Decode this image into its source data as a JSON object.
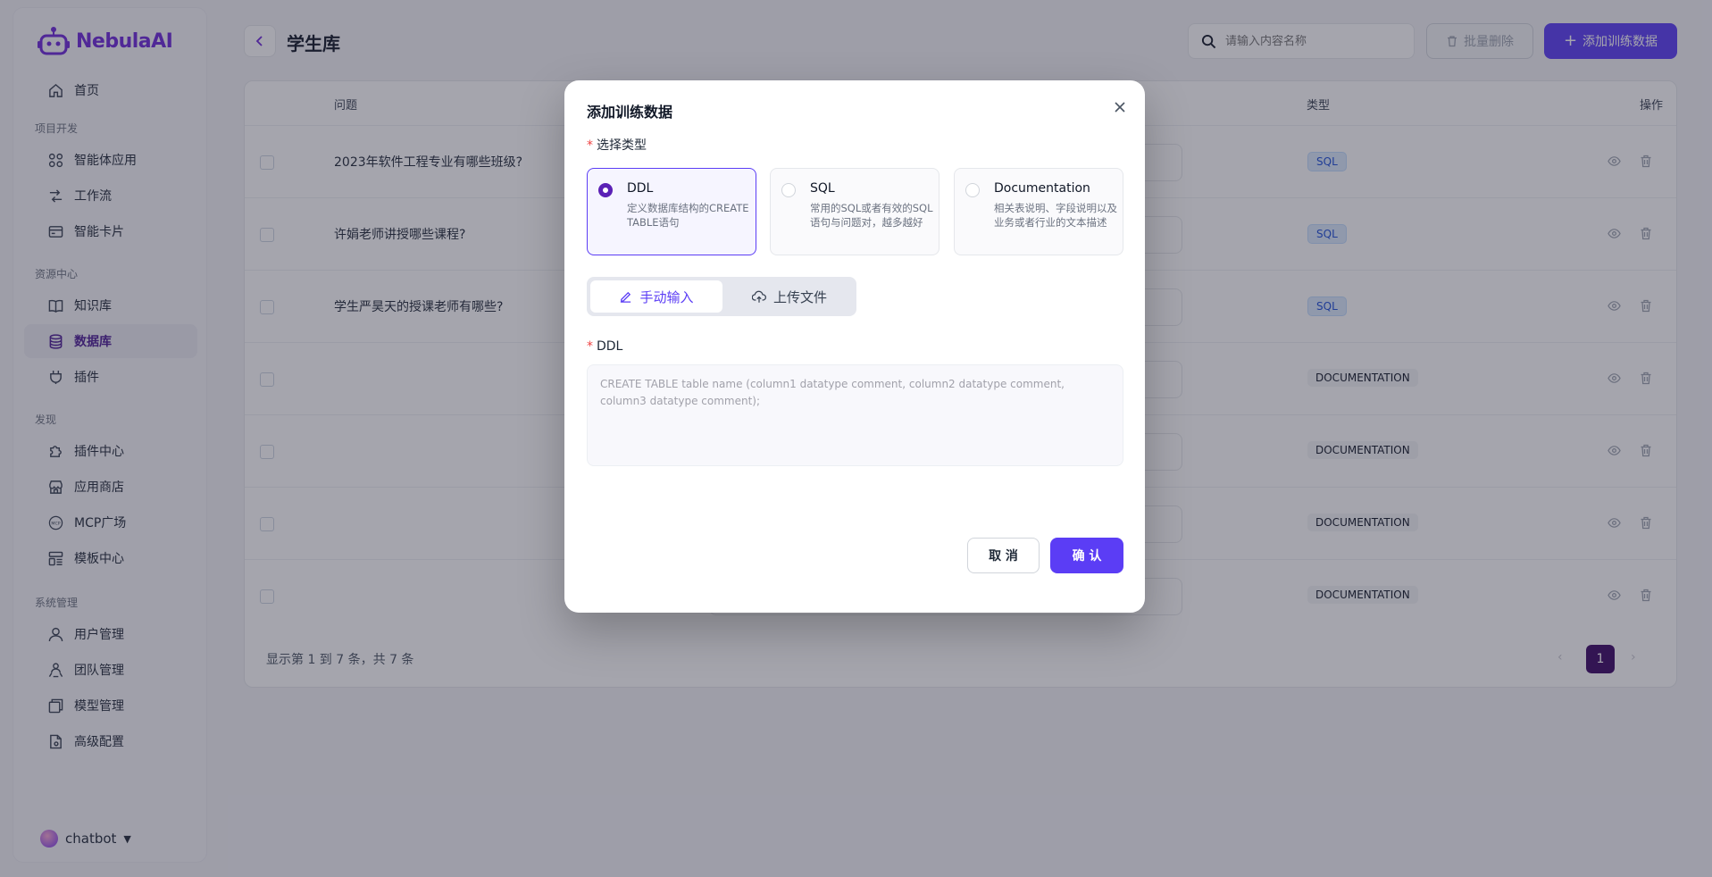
{
  "brand": {
    "name": "NebulaAI",
    "accent": "#6d28d9",
    "primary": "#5b3df5"
  },
  "sidebar": {
    "home": "首页",
    "sections": {
      "project": "项目开发",
      "resource": "资源中心",
      "discover": "发现",
      "system": "系统管理"
    },
    "items": {
      "agent_app": "智能体应用",
      "workflow": "工作流",
      "smart_card": "智能卡片",
      "knowledge": "知识库",
      "database": "数据库",
      "plugin": "插件",
      "plugin_center": "插件中心",
      "app_store": "应用商店",
      "mcp": "MCP广场",
      "template": "模板中心",
      "user_mgmt": "用户管理",
      "team_mgmt": "团队管理",
      "model_mgmt": "模型管理",
      "advanced": "高级配置"
    },
    "user": "chatbot"
  },
  "header": {
    "title": "学生库",
    "search_placeholder": "请输入内容名称",
    "batch_delete": "批量删除",
    "add_training": "添加训练数据"
  },
  "table": {
    "columns": {
      "question": "问题",
      "type": "类型",
      "action": "操作"
    },
    "rows": [
      {
        "question": "2023年软件工程专业有哪些班级?",
        "type": "SQL"
      },
      {
        "question": "许娟老师讲授哪些课程?",
        "type": "SQL"
      },
      {
        "question": "学生严昊天的授课老师有哪些?",
        "type": "SQL"
      },
      {
        "question": "",
        "type": "DOCUMENTATION"
      },
      {
        "question": "",
        "type": "DOCUMENTATION"
      },
      {
        "question": "",
        "type": "DOCUMENTATION"
      },
      {
        "question": "",
        "type": "DOCUMENTATION"
      }
    ],
    "footer": "显示第 1 到 7 条，共 7 条",
    "current_page": "1"
  },
  "modal": {
    "title": "添加训练数据",
    "select_type_label": "选择类型",
    "types": [
      {
        "title": "DDL",
        "desc": "定义数据库结构的CREATE TABLE语句",
        "selected": true
      },
      {
        "title": "SQL",
        "desc": "常用的SQL或者有效的SQL语句与问题对，越多越好",
        "selected": false
      },
      {
        "title": "Documentation",
        "desc": "相关表说明、字段说明以及业务或者行业的文本描述",
        "selected": false
      }
    ],
    "mode_manual": "手动输入",
    "mode_upload": "上传文件",
    "ddl_label": "DDL",
    "ddl_placeholder": "CREATE TABLE table name (column1 datatype comment, column2 datatype comment, column3 datatype comment);",
    "cancel": "取 消",
    "confirm": "确 认"
  }
}
